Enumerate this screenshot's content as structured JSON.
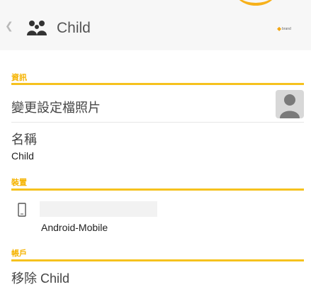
{
  "header": {
    "back_icon": "chevron-left-icon",
    "family_icon": "family-icon",
    "title": "Child",
    "brand_text": "brand logo"
  },
  "sections": {
    "info_header": "資訊",
    "change_photo_label": "變更設定檔照片",
    "name_label": "名稱",
    "name_value": "Child",
    "devices_header": "裝置",
    "device_name": "Android-Mobile",
    "account_header": "帳戶",
    "remove_label": "移除 Child"
  },
  "colors": {
    "accent": "#f6c21e",
    "header_bg": "#f7f7f7"
  }
}
